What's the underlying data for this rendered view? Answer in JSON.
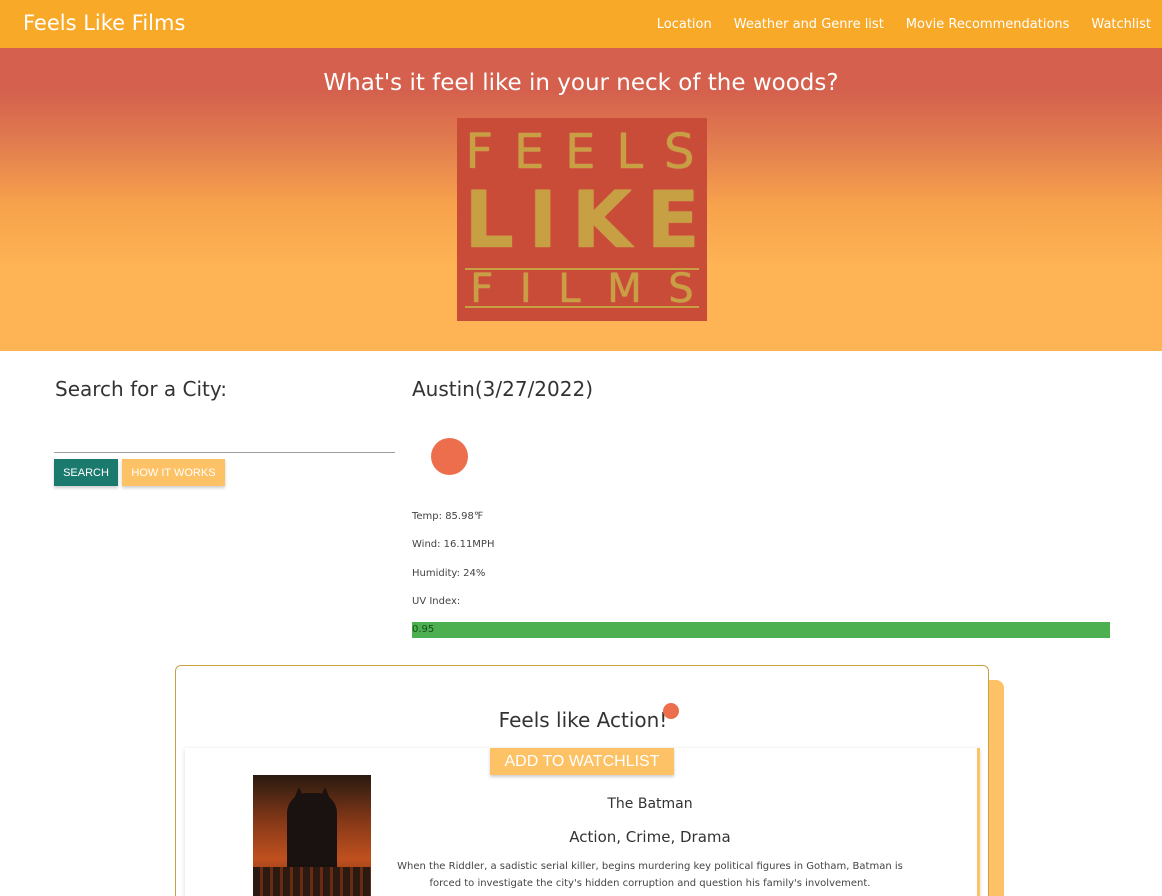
{
  "navbar": {
    "brand": "Feels Like Films",
    "links": [
      "Location",
      "Weather and Genre list",
      "Movie Recommendations",
      "Watchlist"
    ],
    "color": "#f8a928"
  },
  "hero": {
    "title": "What's it feel like in your neck of the woods?",
    "logo": {
      "line1": "FEELS",
      "line2": "LIKE",
      "line3": "FILMS"
    }
  },
  "search": {
    "heading": "Search for a City:",
    "input_value": "",
    "search_label": "SEARCH",
    "how_label": "HOW IT WORKS"
  },
  "weather": {
    "city_date": "Austin(3/27/2022)",
    "temp": "Temp: 85.98℉",
    "wind": "Wind: 16.11MPH",
    "humidity": "Humidity: 24%",
    "uv_label": "UV Index:",
    "uv_value": "0.95",
    "uv_color": "#4caf50"
  },
  "recommendation": {
    "genre_title": "Feels like Action!",
    "watchlist_label": "ADD TO WATCHLIST",
    "movie": {
      "title": "The Batman",
      "genres": "Action, Crime, Drama",
      "description": "When the Riddler, a sadistic serial killer, begins murdering key political figures in Gotham, Batman is forced to investigate the city's hidden corruption and question his family's involvement."
    }
  }
}
